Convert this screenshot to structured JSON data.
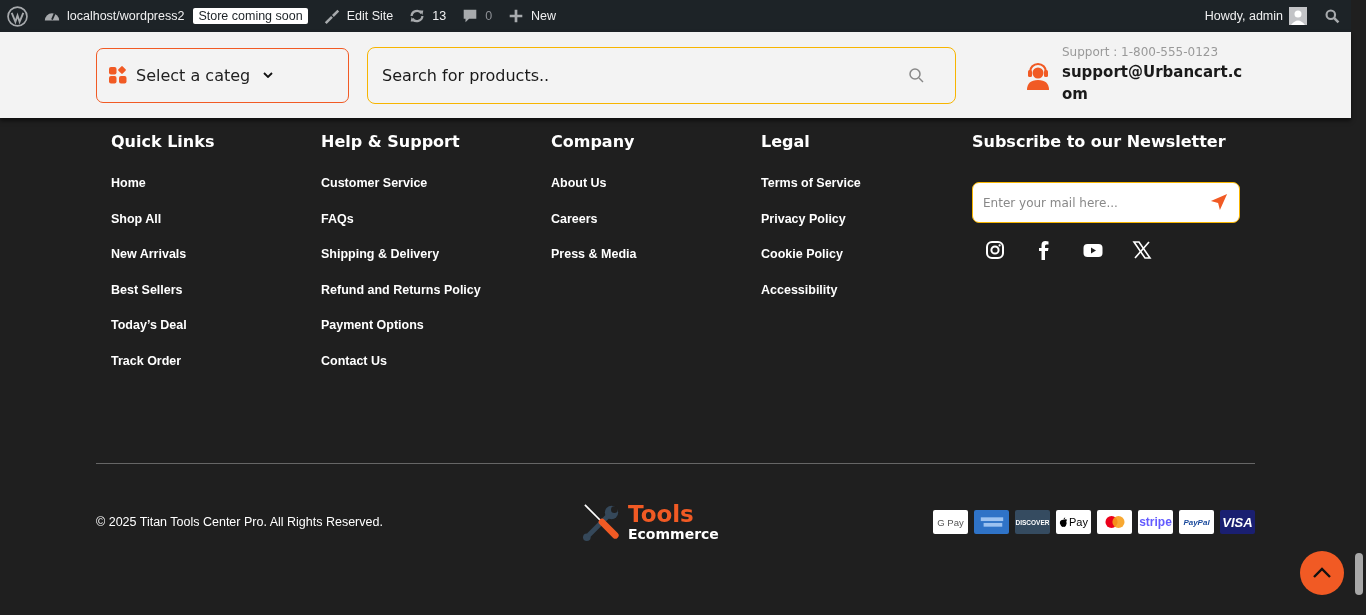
{
  "admin_bar": {
    "site": "localhost/wordpress2",
    "badge": "Store coming soon",
    "edit": "Edit Site",
    "updates": "13",
    "comments": "0",
    "new": "New",
    "greeting": "Howdy, admin"
  },
  "header": {
    "category_select": "Select a categ",
    "search": {
      "placeholder": "Search for products.."
    },
    "support_phone": "Support : 1-800-555-0123",
    "support_email": "support@Urbancart.com"
  },
  "footer_columns": [
    {
      "title": "Quick Links",
      "links": [
        "Home",
        "Shop All",
        "New Arrivals",
        "Best Sellers",
        "Today’s Deal",
        "Track Order"
      ]
    },
    {
      "title": "Help & Support",
      "links": [
        "Customer Service",
        "FAQs",
        "Shipping & Delivery",
        "Refund and Returns Policy",
        "Payment Options",
        "Contact Us"
      ]
    },
    {
      "title": "Company",
      "links": [
        "About Us",
        "Careers",
        "Press & Media"
      ]
    },
    {
      "title": "Legal",
      "links": [
        "Terms of Service",
        "Privacy Policy",
        "Cookie Policy",
        "Accessibility"
      ]
    }
  ],
  "newsletter": {
    "title": "Subscribe to our Newsletter",
    "placeholder": "Enter your mail here...",
    "social": [
      {
        "kind": "instagram"
      },
      {
        "kind": "facebook"
      },
      {
        "kind": "youtube"
      },
      {
        "kind": "x"
      }
    ]
  },
  "copyright": "© 2025 Titan Tools Center Pro. All Rights Reserved.",
  "logo": {
    "title": "Tools",
    "subtitle": "Ecommerce"
  },
  "payments": [
    {
      "kind": "gpay",
      "label": "G Pay"
    },
    {
      "kind": "amex"
    },
    {
      "kind": "discover",
      "label": "DISCOVER"
    },
    {
      "kind": "applepay",
      "label": "Pay"
    },
    {
      "kind": "mastercard"
    },
    {
      "kind": "stripe",
      "label": "stripe"
    },
    {
      "kind": "paypal",
      "label": "PayPal"
    },
    {
      "kind": "visa",
      "label": "VISA"
    }
  ]
}
